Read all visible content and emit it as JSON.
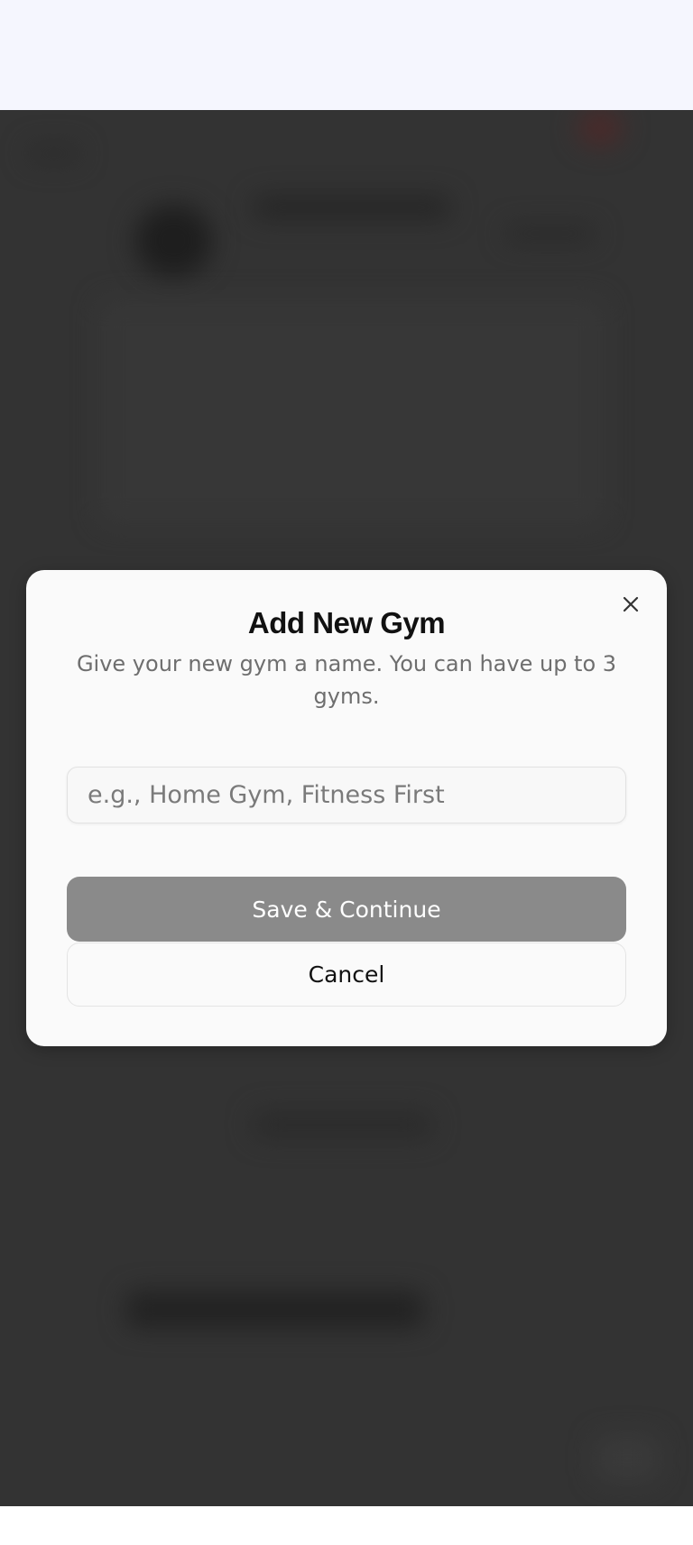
{
  "dialog": {
    "title": "Add New Gym",
    "description": "Give your new gym a name. You can have up to 3 gyms.",
    "input_placeholder": "e.g., Home Gym, Fitness First",
    "input_value": "",
    "save_label": "Save & Continue",
    "cancel_label": "Cancel",
    "close_icon": "close-icon"
  },
  "colors": {
    "overlay": "#333333",
    "status_area": "#f5f6fe",
    "dialog_bg": "#fafafa",
    "save_button_bg": "#8a8a8a"
  }
}
